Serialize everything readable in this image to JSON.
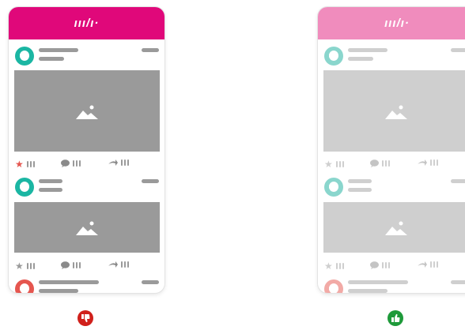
{
  "colors": {
    "brand": "#e0087a",
    "brand_light": "#f08cbd",
    "teal": "#1bb6a3",
    "teal_light": "#8ad6cd",
    "red_avatar": "#e5564f",
    "red_avatar_light": "#f2aaa6",
    "star_red": "#e5564f",
    "gray_dark": "#9a9a9a",
    "gray_light": "#cfcfcf",
    "gray_text": "#bdbdbd",
    "thumbs_down": "#d0201b",
    "thumbs_up": "#1e9a3a"
  },
  "left": {
    "logo": "ııı/ı·",
    "badge_icon": "thumbs-down-icon"
  },
  "right": {
    "logo": "ııı/ı·",
    "badge_icon": "thumbs-up-icon"
  },
  "glyphs": {
    "star": "★",
    "comment": "💬",
    "share": "⇾",
    "thumbs_down": "👎",
    "thumbs_up": "👍"
  }
}
